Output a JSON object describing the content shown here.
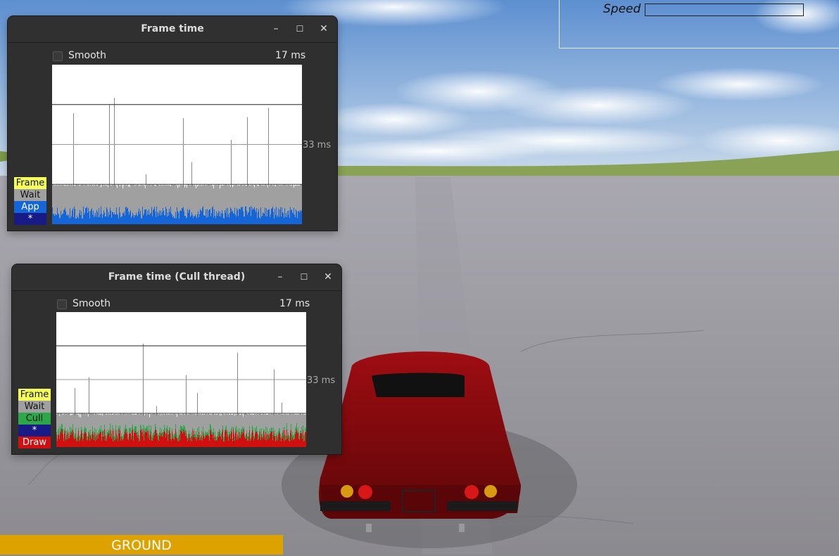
{
  "hud": {
    "speed_label": "Speed",
    "speed_value": 0
  },
  "status": {
    "ground_label": "GROUND"
  },
  "windows": [
    {
      "title": "Frame time",
      "min_icon": "minimize-icon",
      "max_icon": "maximize-icon",
      "close_icon": "close-icon",
      "min_glyph": "–",
      "max_glyph": "☐",
      "close_glyph": "✕",
      "smooth_label": "Smooth",
      "smooth_checked": false,
      "current_ms": "17 ms",
      "ref_label": "33 ms",
      "legend": [
        {
          "label": "Frame",
          "bg": "#f6ff5c",
          "fg": "#111111"
        },
        {
          "label": "Wait",
          "bg": "#a0a0a0",
          "fg": "#111111"
        },
        {
          "label": "App",
          "bg": "#1466d8",
          "fg": "#ffffff"
        },
        {
          "label": "*",
          "bg": "#181a86",
          "fg": "#ffffff"
        }
      ],
      "stack_colors": [
        "#1466d8",
        "#a0a0a0"
      ]
    },
    {
      "title": "Frame time (Cull thread)",
      "min_icon": "minimize-icon",
      "max_icon": "maximize-icon",
      "close_icon": "close-icon",
      "min_glyph": "–",
      "max_glyph": "☐",
      "close_glyph": "✕",
      "smooth_label": "Smooth",
      "smooth_checked": false,
      "current_ms": "17 ms",
      "ref_label": "33 ms",
      "legend": [
        {
          "label": "Frame",
          "bg": "#f6ff5c",
          "fg": "#111111"
        },
        {
          "label": "Wait",
          "bg": "#a0a0a0",
          "fg": "#111111"
        },
        {
          "label": "Cull",
          "bg": "#2aa84a",
          "fg": "#111111"
        },
        {
          "label": "*",
          "bg": "#181a86",
          "fg": "#ffffff"
        },
        {
          "label": "Draw",
          "bg": "#d01010",
          "fg": "#ffffff"
        }
      ],
      "stack_colors": [
        "#d01010",
        "#2aa84a",
        "#a0a0a0"
      ]
    }
  ]
}
